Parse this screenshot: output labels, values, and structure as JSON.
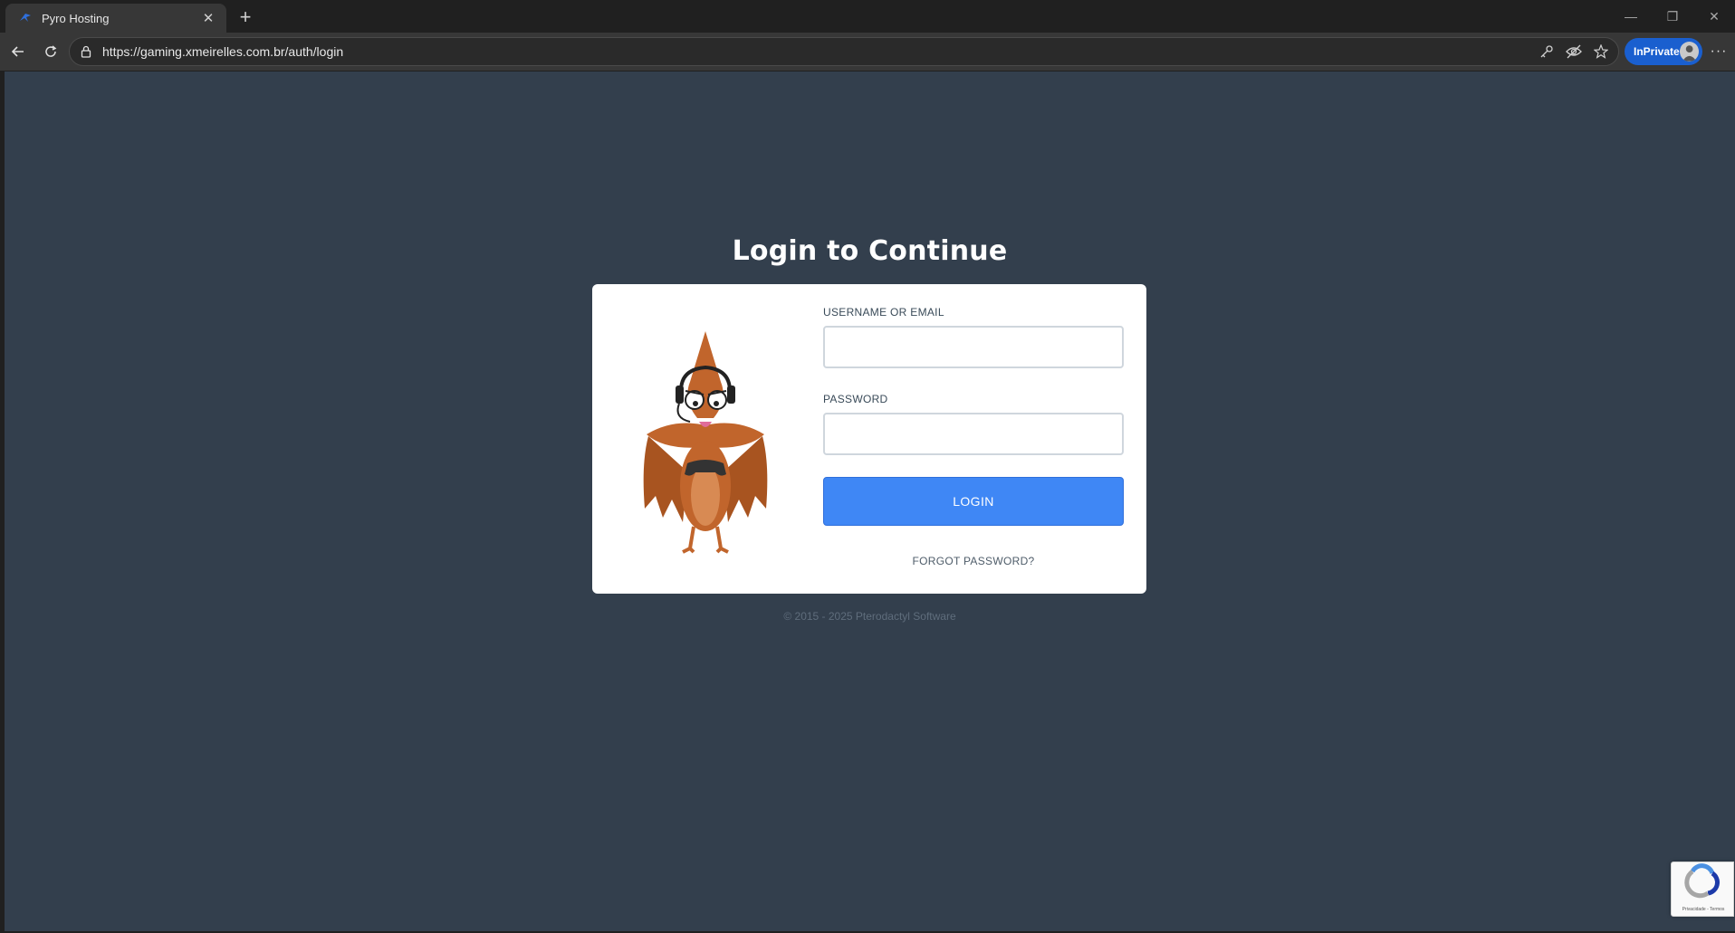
{
  "browser": {
    "tab": {
      "title": "Pyro Hosting",
      "close": "✕"
    },
    "new_tab": "+",
    "window": {
      "minimize": "—",
      "restore": "❐",
      "close": "✕"
    },
    "url": "https://gaming.xmeirelles.com.br/auth/login",
    "inprivate_label": "InPrivate",
    "more": "···"
  },
  "page": {
    "title": "Login to Continue",
    "form": {
      "username_label": "USERNAME OR EMAIL",
      "username_value": "",
      "password_label": "PASSWORD",
      "password_value": "",
      "login_button": "LOGIN",
      "forgot_link": "FORGOT PASSWORD?"
    },
    "footer": "© 2015 - 2025 Pterodactyl Software"
  },
  "recaptcha": {
    "terms": "Privacidade - Termos"
  },
  "colors": {
    "page_background": "#333f4d",
    "card_background": "#ffffff",
    "primary_button": "#3f87f5",
    "inprivate_badge": "#1a5fcf",
    "mascot_body": "#c1652c"
  }
}
